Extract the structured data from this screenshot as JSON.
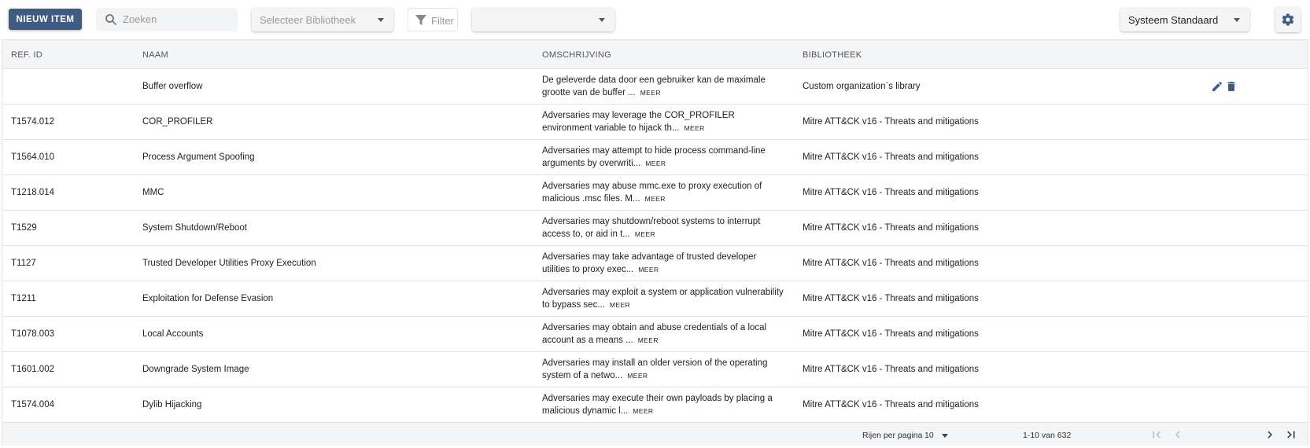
{
  "toolbar": {
    "new_item_label": "NIEUW ITEM",
    "search_placeholder": "Zoeken",
    "library_select_placeholder": "Selecteer Bibliotheek",
    "filter_label": "Filter",
    "empty_select_value": "",
    "system_select_value": "Systeem Standaard",
    "accent_color": "#3f5b82",
    "icons": [
      "search-icon",
      "filter-icon",
      "chevron-down-icon",
      "gear-icon"
    ]
  },
  "table": {
    "columns": [
      "REF. ID",
      "NAAM",
      "OMSCHRIJVING",
      "BIBLIOTHEEK"
    ],
    "more_label": "MEER",
    "rows": [
      {
        "ref": "",
        "name": "Buffer overflow",
        "desc": "De geleverde data door een gebruiker kan de maximale grootte van de buffer ...",
        "lib": "Custom organization`s library",
        "actions": [
          "pencil-icon",
          "trash-icon"
        ]
      },
      {
        "ref": "T1574.012",
        "name": "COR_PROFILER",
        "desc": "Adversaries may leverage the COR_PROFILER environment variable to hijack th...",
        "lib": "Mitre ATT&CK v16 - Threats and mitigations"
      },
      {
        "ref": "T1564.010",
        "name": "Process Argument Spoofing",
        "desc": "Adversaries may attempt to hide process command-line arguments by overwriti...",
        "lib": "Mitre ATT&CK v16 - Threats and mitigations"
      },
      {
        "ref": "T1218.014",
        "name": "MMC",
        "desc": "Adversaries may abuse mmc.exe to proxy execution of malicious .msc files. M...",
        "lib": "Mitre ATT&CK v16 - Threats and mitigations"
      },
      {
        "ref": "T1529",
        "name": "System Shutdown/Reboot",
        "desc": "Adversaries may shutdown/reboot systems to interrupt access to, or aid in t...",
        "lib": "Mitre ATT&CK v16 - Threats and mitigations"
      },
      {
        "ref": "T1127",
        "name": "Trusted Developer Utilities Proxy Execution",
        "desc": "Adversaries may take advantage of trusted developer utilities to proxy exec...",
        "lib": "Mitre ATT&CK v16 - Threats and mitigations"
      },
      {
        "ref": "T1211",
        "name": "Exploitation for Defense Evasion",
        "desc": "Adversaries may exploit a system or application vulnerability to bypass sec...",
        "lib": "Mitre ATT&CK v16 - Threats and mitigations"
      },
      {
        "ref": "T1078.003",
        "name": "Local Accounts",
        "desc": "Adversaries may obtain and abuse credentials of a local account as a means ...",
        "lib": "Mitre ATT&CK v16 - Threats and mitigations"
      },
      {
        "ref": "T1601.002",
        "name": "Downgrade System Image",
        "desc": "Adversaries may install an older version of the operating system of a netwo...",
        "lib": "Mitre ATT&CK v16 - Threats and mitigations"
      },
      {
        "ref": "T1574.004",
        "name": "Dylib Hijacking",
        "desc": "Adversaries may execute their own payloads by placing a malicious dynamic l...",
        "lib": "Mitre ATT&CK v16 - Threats and mitigations"
      }
    ]
  },
  "pagination": {
    "rows_per_page_label": "Rijen per pagina",
    "rows_per_page_value": "10",
    "range_text": "1-10 van 632",
    "icons": [
      "first-page-icon",
      "prev-page-icon",
      "next-page-icon",
      "last-page-icon"
    ]
  }
}
